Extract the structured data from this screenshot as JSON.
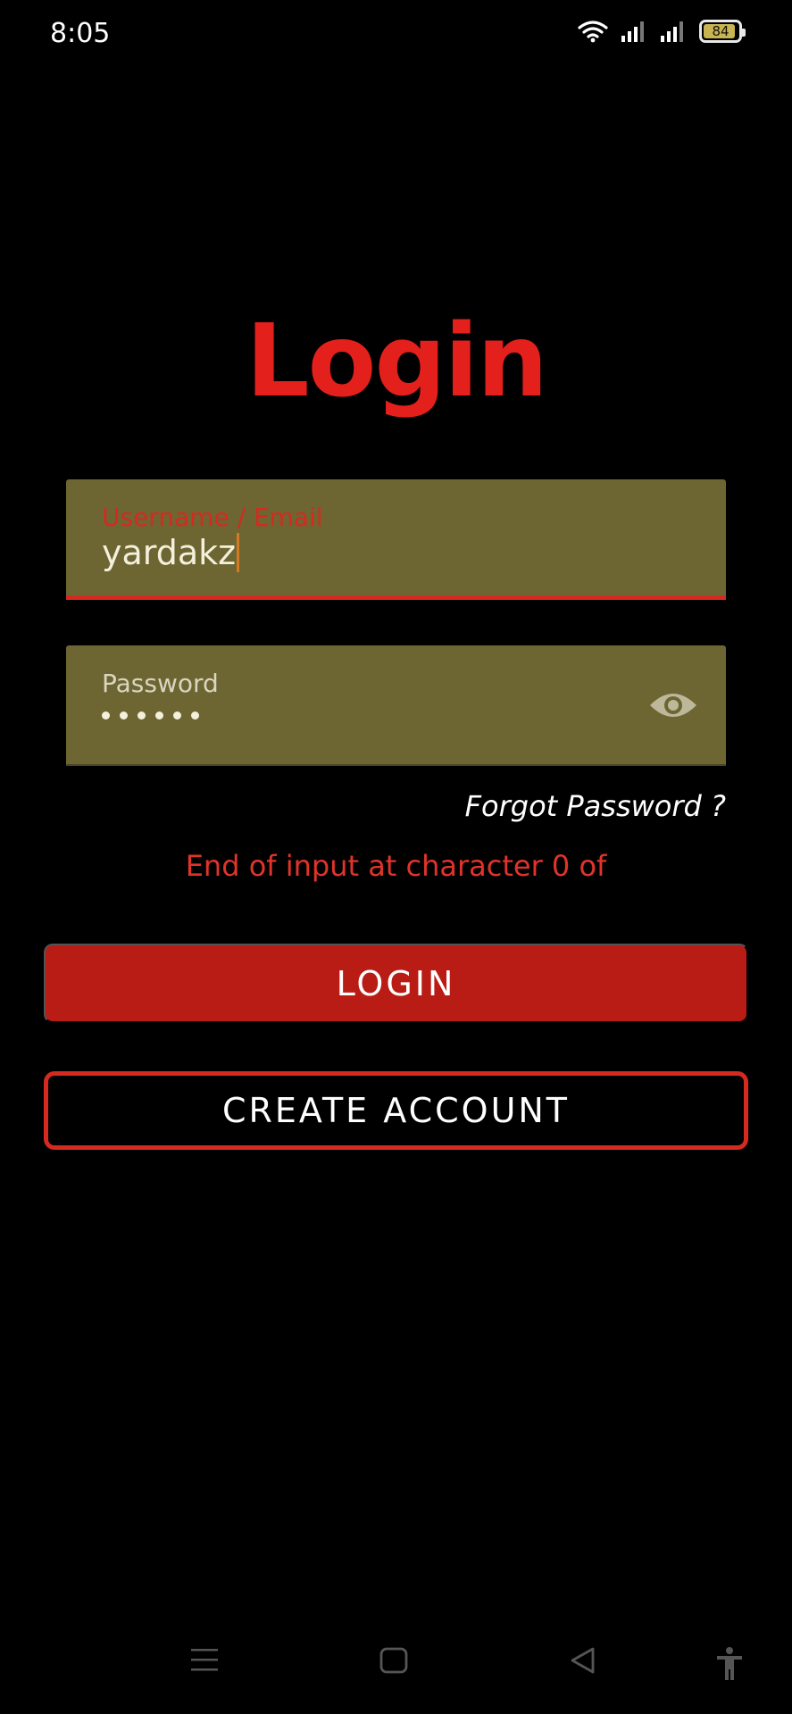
{
  "status_bar": {
    "time": "8:05",
    "battery_level": "84",
    "icons": [
      "wifi-icon",
      "signal-icon",
      "signal-icon",
      "battery-icon"
    ]
  },
  "page": {
    "title": "Login"
  },
  "form": {
    "username": {
      "label": "Username / Email",
      "value": "yardakz"
    },
    "password": {
      "label": "Password",
      "masked_length": 6,
      "toggle_icon": "eye-icon"
    },
    "forgot_password": "Forgot Password ?",
    "error_message": "End of input at character 0 of"
  },
  "buttons": {
    "login": "LOGIN",
    "create_account": "CREATE ACCOUNT"
  },
  "navigation": {
    "icons": [
      "menu-icon",
      "home-icon",
      "back-icon",
      "accessibility-icon"
    ]
  },
  "colors": {
    "background": "#000000",
    "accent_red": "#e3201b",
    "button_red": "#b91c15",
    "field_olive": "#6d6632",
    "error_red": "#e0342a"
  }
}
